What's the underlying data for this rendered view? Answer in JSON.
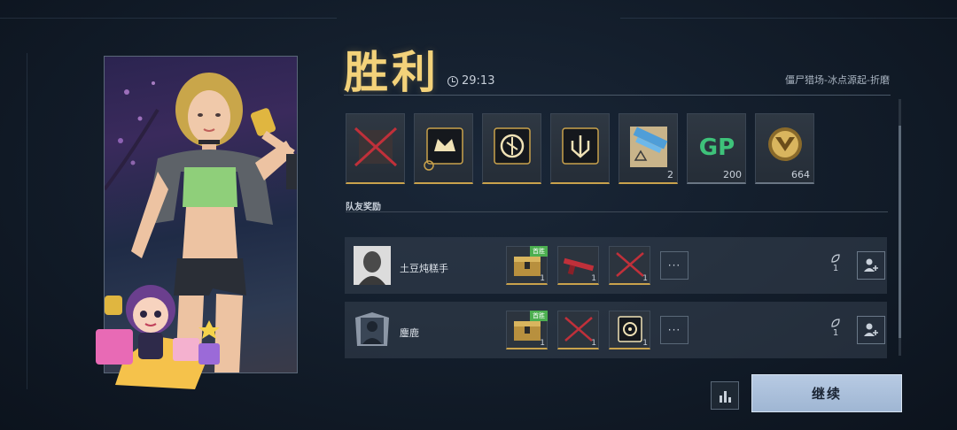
{
  "result": {
    "title": "胜利",
    "duration": "29:13",
    "mode": "僵尸猎场-冰点源起-折磨"
  },
  "rewards": [
    {
      "icon": "locked-crossed-icon",
      "count": ""
    },
    {
      "icon": "emblem-crown-icon",
      "count": ""
    },
    {
      "icon": "emblem-shield-icon",
      "count": ""
    },
    {
      "icon": "emblem-trident-icon",
      "count": ""
    },
    {
      "icon": "weapon-blueprint-icon",
      "count": "2"
    },
    {
      "icon": "gp-currency-icon",
      "count": "200"
    },
    {
      "icon": "gold-emblem-coin-icon",
      "count": "664"
    }
  ],
  "team": {
    "section_label": "队友奖励",
    "members": [
      {
        "name": "土豆炖糕手",
        "items": [
          {
            "icon": "gold-crate-icon",
            "count": "1",
            "badge": "首胜"
          },
          {
            "icon": "red-rifle-icon",
            "count": "1",
            "badge": ""
          },
          {
            "icon": "locked-crossed-icon",
            "count": "1",
            "badge": ""
          }
        ],
        "more": "···",
        "likes": "1"
      },
      {
        "name": "鏖鹿",
        "items": [
          {
            "icon": "gold-crate-icon",
            "count": "1",
            "badge": "首胜"
          },
          {
            "icon": "locked-crossed-icon",
            "count": "1",
            "badge": ""
          },
          {
            "icon": "target-emblem-icon",
            "count": "1",
            "badge": ""
          }
        ],
        "more": "···",
        "likes": "1"
      }
    ]
  },
  "actions": {
    "continue_label": "继续"
  },
  "colors": {
    "accent_gold": "#f3d27a",
    "button_blue": "#a9bfdc",
    "badge_green": "#4caf50"
  }
}
